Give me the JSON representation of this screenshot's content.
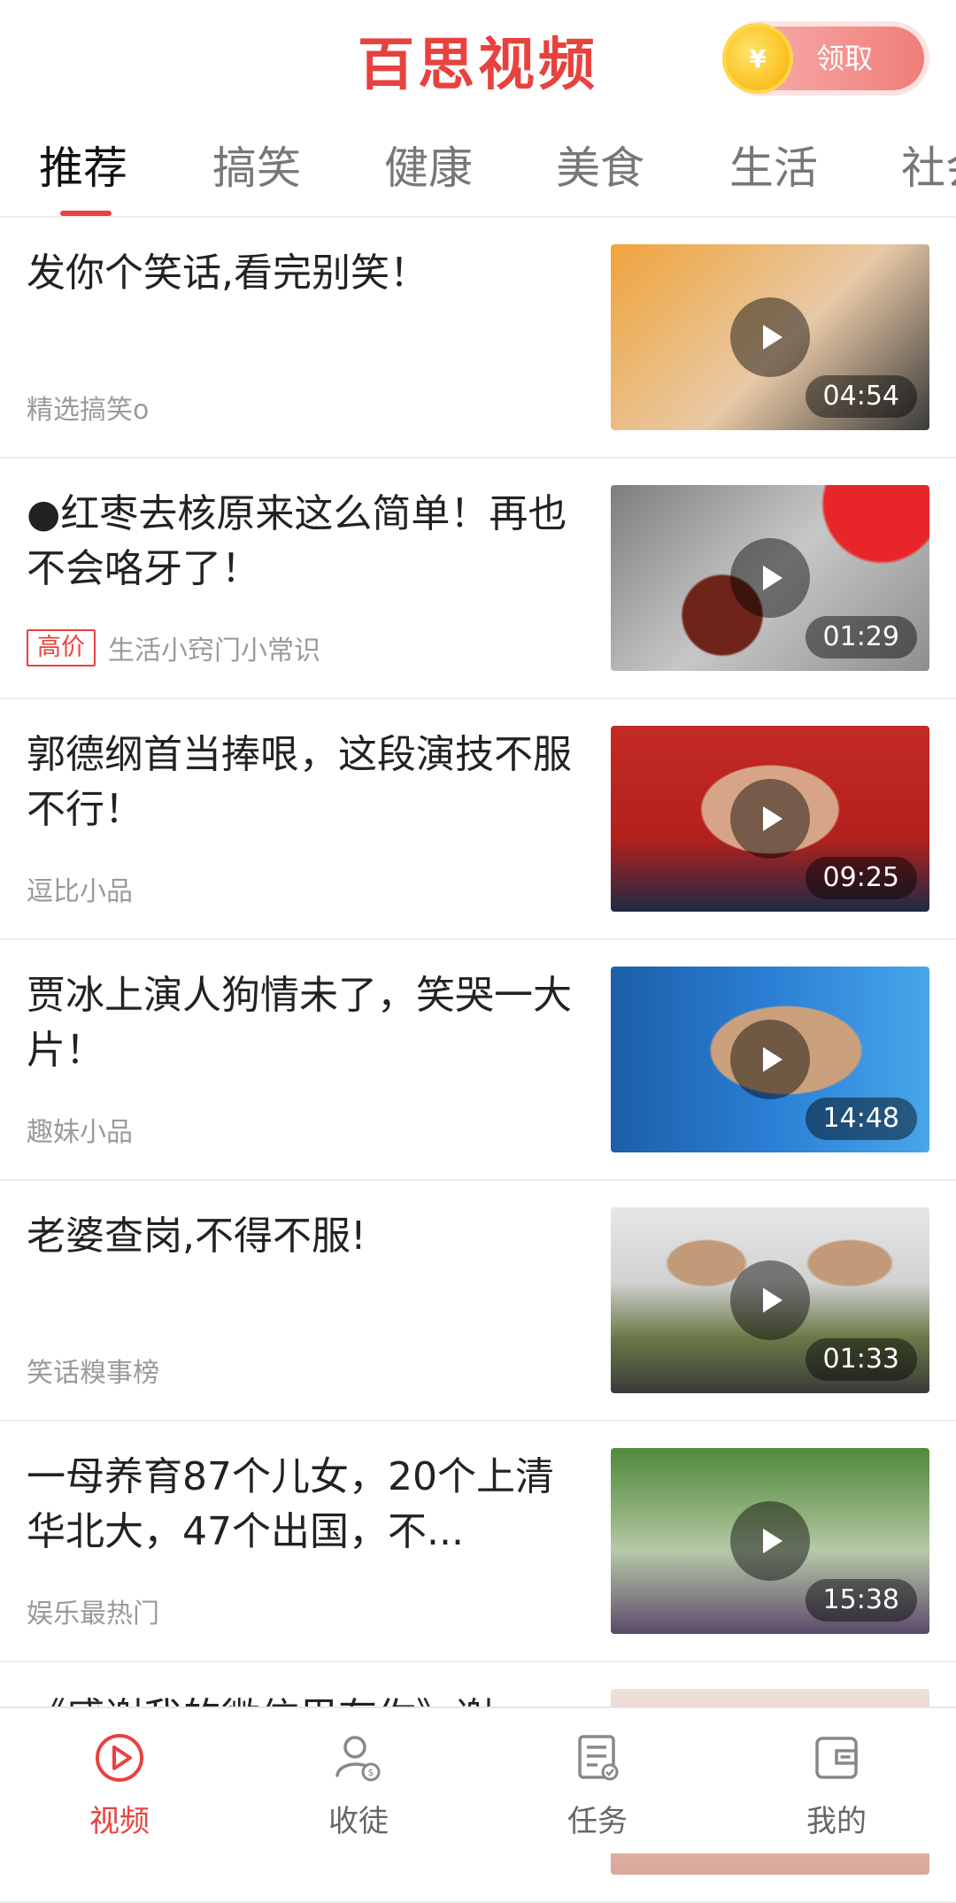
{
  "header": {
    "app_title": "百思视频",
    "claim_button_label": "领取",
    "coin_symbol": "¥"
  },
  "tabs": [
    {
      "label": "推荐",
      "active": true
    },
    {
      "label": "搞笑"
    },
    {
      "label": "健康"
    },
    {
      "label": "美食"
    },
    {
      "label": "生活"
    },
    {
      "label": "社会"
    }
  ],
  "feed": {
    "items": [
      {
        "title": "发你个笑话,看完别笑！",
        "source": "精选搞笑o",
        "badge": "",
        "duration": "04:54",
        "thumb_colors": [
          "#f0a43c",
          "#e8c9a6"
        ]
      },
      {
        "title": "●红枣去核原来这么简单！再也不会咯牙了！",
        "source": "生活小窍门小常识",
        "badge": "高价",
        "duration": "01:29",
        "thumb_colors": [
          "#8e8e8e",
          "#c7c7c7"
        ]
      },
      {
        "title": "郭德纲首当捧哏，这段演技不服不行！",
        "source": "逗比小品",
        "badge": "",
        "duration": "09:25",
        "thumb_colors": [
          "#c32a25",
          "#d59f7f"
        ]
      },
      {
        "title": "贾冰上演人狗情未了，笑哭一大片！",
        "source": "趣妹小品",
        "badge": "",
        "duration": "14:48",
        "thumb_colors": [
          "#2a7fd4",
          "#caa07d"
        ]
      },
      {
        "title": "老婆查岗,不得不服!",
        "source": "笑话糗事榜",
        "badge": "",
        "duration": "01:33",
        "thumb_colors": [
          "#6b7a48",
          "#d8d8d8"
        ]
      },
      {
        "title": "一母养育87个儿女，20个上清华北大，47个出国，不...",
        "source": "娱乐最热门",
        "badge": "",
        "duration": "15:38",
        "thumb_colors": [
          "#4f8a3d",
          "#b7c9a9"
        ]
      },
      {
        "title": "《感谢我的微信里有你》谢",
        "source": "",
        "badge": "",
        "duration": "",
        "thumb_colors": [
          "#d9a79a",
          "#efe0da"
        ]
      }
    ]
  },
  "bottom_nav": [
    {
      "label": "视频",
      "icon": "video-play-icon",
      "active": true
    },
    {
      "label": "收徒",
      "icon": "user-coin-icon"
    },
    {
      "label": "任务",
      "icon": "task-list-icon"
    },
    {
      "label": "我的",
      "icon": "wallet-icon"
    }
  ],
  "colors": {
    "brand": "#e8423f",
    "tab_inactive": "#777777",
    "meta_text": "#9a9a9a"
  }
}
